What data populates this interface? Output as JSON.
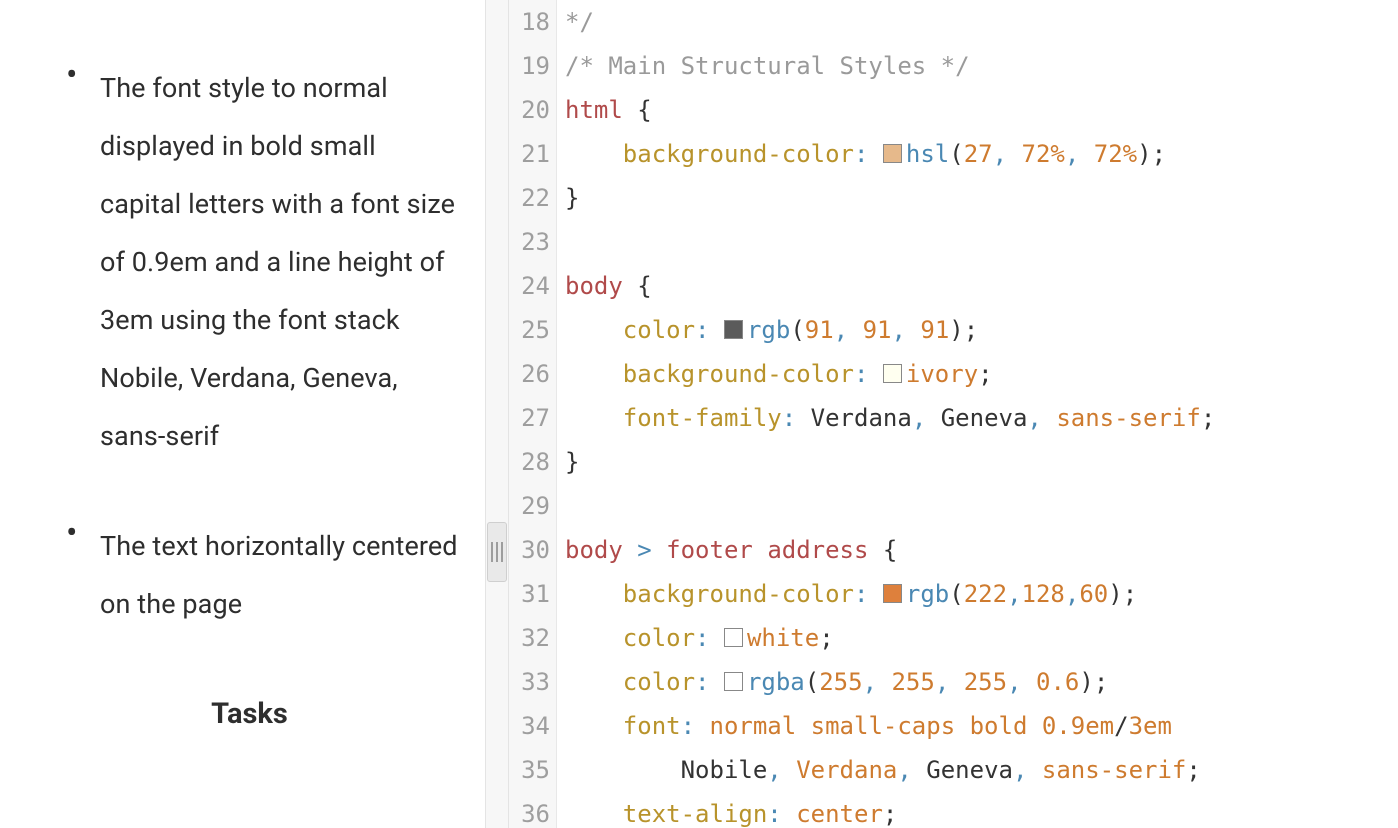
{
  "sidebar": {
    "top_fragment": "...;",
    "items": [
      {
        "text": "The font style to normal displayed in bold small capital letters with a font size of 0.9em and a line height of 3em using the font stack Nobile, Verdana, Geneva, sans-serif"
      },
      {
        "text": "The text horizontally centered on the page"
      }
    ],
    "tasks_heading": "Tasks"
  },
  "editor": {
    "first_line_number": 18,
    "lines": [
      {
        "n": 18,
        "tokens": [
          {
            "t": "*/",
            "c": "comment"
          }
        ]
      },
      {
        "n": 19,
        "tokens": [
          {
            "t": "/* Main Structural Styles */",
            "c": "comment"
          }
        ]
      },
      {
        "n": 20,
        "tokens": [
          {
            "t": "html",
            "c": "selector"
          },
          {
            "t": " ",
            "c": "punct"
          },
          {
            "t": "{",
            "c": "punct"
          }
        ]
      },
      {
        "n": 21,
        "tokens": [
          {
            "t": "    ",
            "c": "punct"
          },
          {
            "t": "background-color",
            "c": "prop"
          },
          {
            "t": ":",
            "c": "colon"
          },
          {
            "t": " ",
            "c": "punct"
          },
          {
            "swatch": "#e6b98b"
          },
          {
            "t": "hsl",
            "c": "func"
          },
          {
            "t": "(",
            "c": "punct"
          },
          {
            "t": "27",
            "c": "number"
          },
          {
            "t": ",",
            "c": "opblue"
          },
          {
            "t": " ",
            "c": "punct"
          },
          {
            "t": "72%",
            "c": "number"
          },
          {
            "t": ",",
            "c": "opblue"
          },
          {
            "t": " ",
            "c": "punct"
          },
          {
            "t": "72%",
            "c": "number"
          },
          {
            "t": ")",
            "c": "punct"
          },
          {
            "t": ";",
            "c": "punct"
          }
        ]
      },
      {
        "n": 22,
        "tokens": [
          {
            "t": "}",
            "c": "punct"
          }
        ]
      },
      {
        "n": 23,
        "tokens": []
      },
      {
        "n": 24,
        "tokens": [
          {
            "t": "body",
            "c": "selector"
          },
          {
            "t": " ",
            "c": "punct"
          },
          {
            "t": "{",
            "c": "punct"
          }
        ]
      },
      {
        "n": 25,
        "tokens": [
          {
            "t": "    ",
            "c": "punct"
          },
          {
            "t": "color",
            "c": "prop"
          },
          {
            "t": ":",
            "c": "colon"
          },
          {
            "t": " ",
            "c": "punct"
          },
          {
            "swatch": "#5b5b5b"
          },
          {
            "t": "rgb",
            "c": "func"
          },
          {
            "t": "(",
            "c": "punct"
          },
          {
            "t": "91",
            "c": "number"
          },
          {
            "t": ",",
            "c": "opblue"
          },
          {
            "t": " ",
            "c": "punct"
          },
          {
            "t": "91",
            "c": "number"
          },
          {
            "t": ",",
            "c": "opblue"
          },
          {
            "t": " ",
            "c": "punct"
          },
          {
            "t": "91",
            "c": "number"
          },
          {
            "t": ")",
            "c": "punct"
          },
          {
            "t": ";",
            "c": "punct"
          }
        ]
      },
      {
        "n": 26,
        "tokens": [
          {
            "t": "    ",
            "c": "punct"
          },
          {
            "t": "background-color",
            "c": "prop"
          },
          {
            "t": ":",
            "c": "colon"
          },
          {
            "t": " ",
            "c": "punct"
          },
          {
            "swatch": "#fffff0"
          },
          {
            "t": "ivory",
            "c": "string"
          },
          {
            "t": ";",
            "c": "punct"
          }
        ]
      },
      {
        "n": 27,
        "tokens": [
          {
            "t": "    ",
            "c": "punct"
          },
          {
            "t": "font-family",
            "c": "prop"
          },
          {
            "t": ":",
            "c": "colon"
          },
          {
            "t": " ",
            "c": "punct"
          },
          {
            "t": "Verdana",
            "c": "value"
          },
          {
            "t": ",",
            "c": "opblue"
          },
          {
            "t": " ",
            "c": "punct"
          },
          {
            "t": "Geneva",
            "c": "value"
          },
          {
            "t": ",",
            "c": "opblue"
          },
          {
            "t": " ",
            "c": "punct"
          },
          {
            "t": "sans-serif",
            "c": "string"
          },
          {
            "t": ";",
            "c": "punct"
          }
        ]
      },
      {
        "n": 28,
        "tokens": [
          {
            "t": "}",
            "c": "punct"
          }
        ]
      },
      {
        "n": 29,
        "tokens": []
      },
      {
        "n": 30,
        "tokens": [
          {
            "t": "body",
            "c": "selector"
          },
          {
            "t": " ",
            "c": "punct"
          },
          {
            "t": ">",
            "c": "opblue"
          },
          {
            "t": " ",
            "c": "punct"
          },
          {
            "t": "footer",
            "c": "selector"
          },
          {
            "t": " ",
            "c": "punct"
          },
          {
            "t": "address",
            "c": "selector"
          },
          {
            "t": " ",
            "c": "punct"
          },
          {
            "t": "{",
            "c": "punct"
          }
        ]
      },
      {
        "n": 31,
        "tokens": [
          {
            "t": "    ",
            "c": "punct"
          },
          {
            "t": "background-color",
            "c": "prop"
          },
          {
            "t": ":",
            "c": "colon"
          },
          {
            "t": " ",
            "c": "punct"
          },
          {
            "swatch": "#de803c"
          },
          {
            "t": "rgb",
            "c": "func"
          },
          {
            "t": "(",
            "c": "punct"
          },
          {
            "t": "222",
            "c": "number"
          },
          {
            "t": ",",
            "c": "opblue"
          },
          {
            "t": "128",
            "c": "number"
          },
          {
            "t": ",",
            "c": "opblue"
          },
          {
            "t": "60",
            "c": "number"
          },
          {
            "t": ")",
            "c": "punct"
          },
          {
            "t": ";",
            "c": "punct"
          }
        ]
      },
      {
        "n": 32,
        "tokens": [
          {
            "t": "    ",
            "c": "punct"
          },
          {
            "t": "color",
            "c": "prop"
          },
          {
            "t": ":",
            "c": "colon"
          },
          {
            "t": " ",
            "c": "punct"
          },
          {
            "swatch": "#ffffff"
          },
          {
            "t": "white",
            "c": "string"
          },
          {
            "t": ";",
            "c": "punct"
          }
        ]
      },
      {
        "n": 33,
        "tokens": [
          {
            "t": "    ",
            "c": "punct"
          },
          {
            "t": "color",
            "c": "prop"
          },
          {
            "t": ":",
            "c": "colon"
          },
          {
            "t": " ",
            "c": "punct"
          },
          {
            "swatch": "rgba(255,255,255,0.6)"
          },
          {
            "t": "rgba",
            "c": "func"
          },
          {
            "t": "(",
            "c": "punct"
          },
          {
            "t": "255",
            "c": "number"
          },
          {
            "t": ",",
            "c": "opblue"
          },
          {
            "t": " ",
            "c": "punct"
          },
          {
            "t": "255",
            "c": "number"
          },
          {
            "t": ",",
            "c": "opblue"
          },
          {
            "t": " ",
            "c": "punct"
          },
          {
            "t": "255",
            "c": "number"
          },
          {
            "t": ",",
            "c": "opblue"
          },
          {
            "t": " ",
            "c": "punct"
          },
          {
            "t": "0.6",
            "c": "number"
          },
          {
            "t": ")",
            "c": "punct"
          },
          {
            "t": ";",
            "c": "punct"
          }
        ]
      },
      {
        "n": 34,
        "tokens": [
          {
            "t": "    ",
            "c": "punct"
          },
          {
            "t": "font",
            "c": "prop"
          },
          {
            "t": ":",
            "c": "colon"
          },
          {
            "t": " ",
            "c": "punct"
          },
          {
            "t": "normal",
            "c": "string"
          },
          {
            "t": " ",
            "c": "punct"
          },
          {
            "t": "small-caps",
            "c": "string"
          },
          {
            "t": " ",
            "c": "punct"
          },
          {
            "t": "bold",
            "c": "string"
          },
          {
            "t": " ",
            "c": "punct"
          },
          {
            "t": "0.9em",
            "c": "number"
          },
          {
            "t": "/",
            "c": "punct"
          },
          {
            "t": "3em",
            "c": "string"
          }
        ]
      },
      {
        "n": 35,
        "tokens": [
          {
            "t": "        ",
            "c": "punct"
          },
          {
            "t": "Nobile",
            "c": "value"
          },
          {
            "t": ",",
            "c": "opblue"
          },
          {
            "t": " ",
            "c": "punct"
          },
          {
            "t": "Verdana",
            "c": "string"
          },
          {
            "t": ",",
            "c": "opblue"
          },
          {
            "t": " ",
            "c": "punct"
          },
          {
            "t": "Geneva",
            "c": "value"
          },
          {
            "t": ",",
            "c": "opblue"
          },
          {
            "t": " ",
            "c": "punct"
          },
          {
            "t": "sans-serif",
            "c": "string"
          },
          {
            "t": ";",
            "c": "punct"
          }
        ]
      },
      {
        "n": 36,
        "tokens": [
          {
            "t": "    ",
            "c": "punct"
          },
          {
            "t": "text-align",
            "c": "prop"
          },
          {
            "t": ":",
            "c": "colon"
          },
          {
            "t": " ",
            "c": "punct"
          },
          {
            "t": "center",
            "c": "string"
          },
          {
            "t": ";",
            "c": "punct"
          }
        ]
      }
    ]
  },
  "colors": {
    "comment": "#9a9a9a",
    "selector": "#b04a4a",
    "property": "#b8932b",
    "operator_blue": "#4a88b3",
    "number_orange": "#ce7b2f"
  }
}
